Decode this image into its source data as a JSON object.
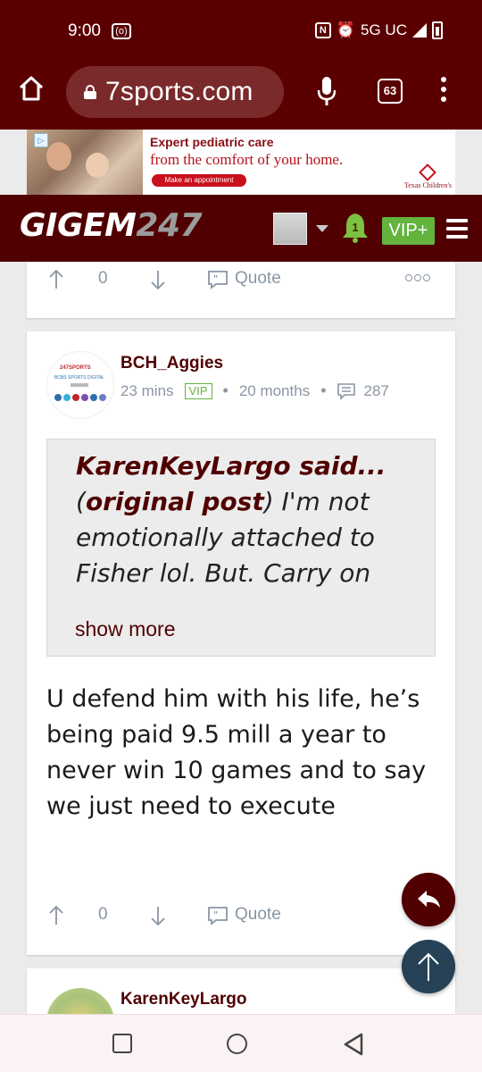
{
  "status_bar": {
    "time": "9:00",
    "network": "5G UC"
  },
  "browser": {
    "url": "7sports.com",
    "tab_count": "63"
  },
  "ad": {
    "line1": "Expert pediatric care",
    "line2": "from the comfort of your home.",
    "cta": "Make an appointment",
    "brand": "Texas Children's"
  },
  "site_header": {
    "logo_main": "GIGEM",
    "logo_num": "247",
    "notification_count": "1",
    "vip_label": "VIP+"
  },
  "top_post_actions": {
    "vote_count": "0",
    "quote_label": "Quote"
  },
  "post": {
    "username": "BCH_Aggies",
    "time_ago": "23 mins",
    "badge": "VIP",
    "member_for": "20 months",
    "post_count": "287",
    "quoted": {
      "author": "KarenKeyLargo said...",
      "link_label": "original post",
      "open_paren": "(",
      "text": ") I'm not emotionally attached to Fisher lol. But. Carry on",
      "show_more": "show more"
    },
    "body": "U defend him with his life, he’s being paid 9.5 mill a year to never win 10 games and to say we just need to execute",
    "vote_count": "0",
    "quote_label": "Quote"
  },
  "next_post": {
    "username": "KarenKeyLargo"
  },
  "colors": {
    "maroon": "#500000",
    "vip_green": "#63b33d",
    "fab_blue": "#274256"
  }
}
